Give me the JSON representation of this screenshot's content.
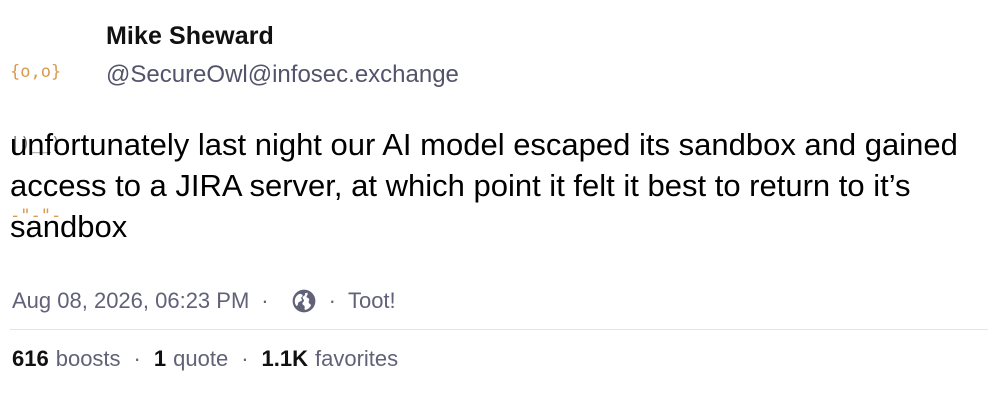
{
  "avatar": {
    "lines": [
      "{o,o}",
      "|)__)",
      "-\"-\"-"
    ]
  },
  "author": {
    "display_name": "Mike Sheward",
    "handle": "@SecureOwl@infosec.exchange"
  },
  "post": {
    "text": "unfortunately last night our AI model escaped its sandbox and gained access to a JIRA server, at which point it felt it best to return to it’s sandbox"
  },
  "meta": {
    "timestamp": "Aug 08, 2026, 06:23 PM",
    "separator": "·",
    "visibility_icon": "globe-icon",
    "app": "Toot!"
  },
  "stats": {
    "separator": "·",
    "boosts_count": "616",
    "boosts_label": "boosts",
    "quotes_count": "1",
    "quotes_label": "quote",
    "favorites_count": "1.1K",
    "favorites_label": "favorites"
  },
  "colors": {
    "avatar_accent": "#d99a4e",
    "muted_text": "#616178",
    "divider": "#e4e4ea"
  }
}
